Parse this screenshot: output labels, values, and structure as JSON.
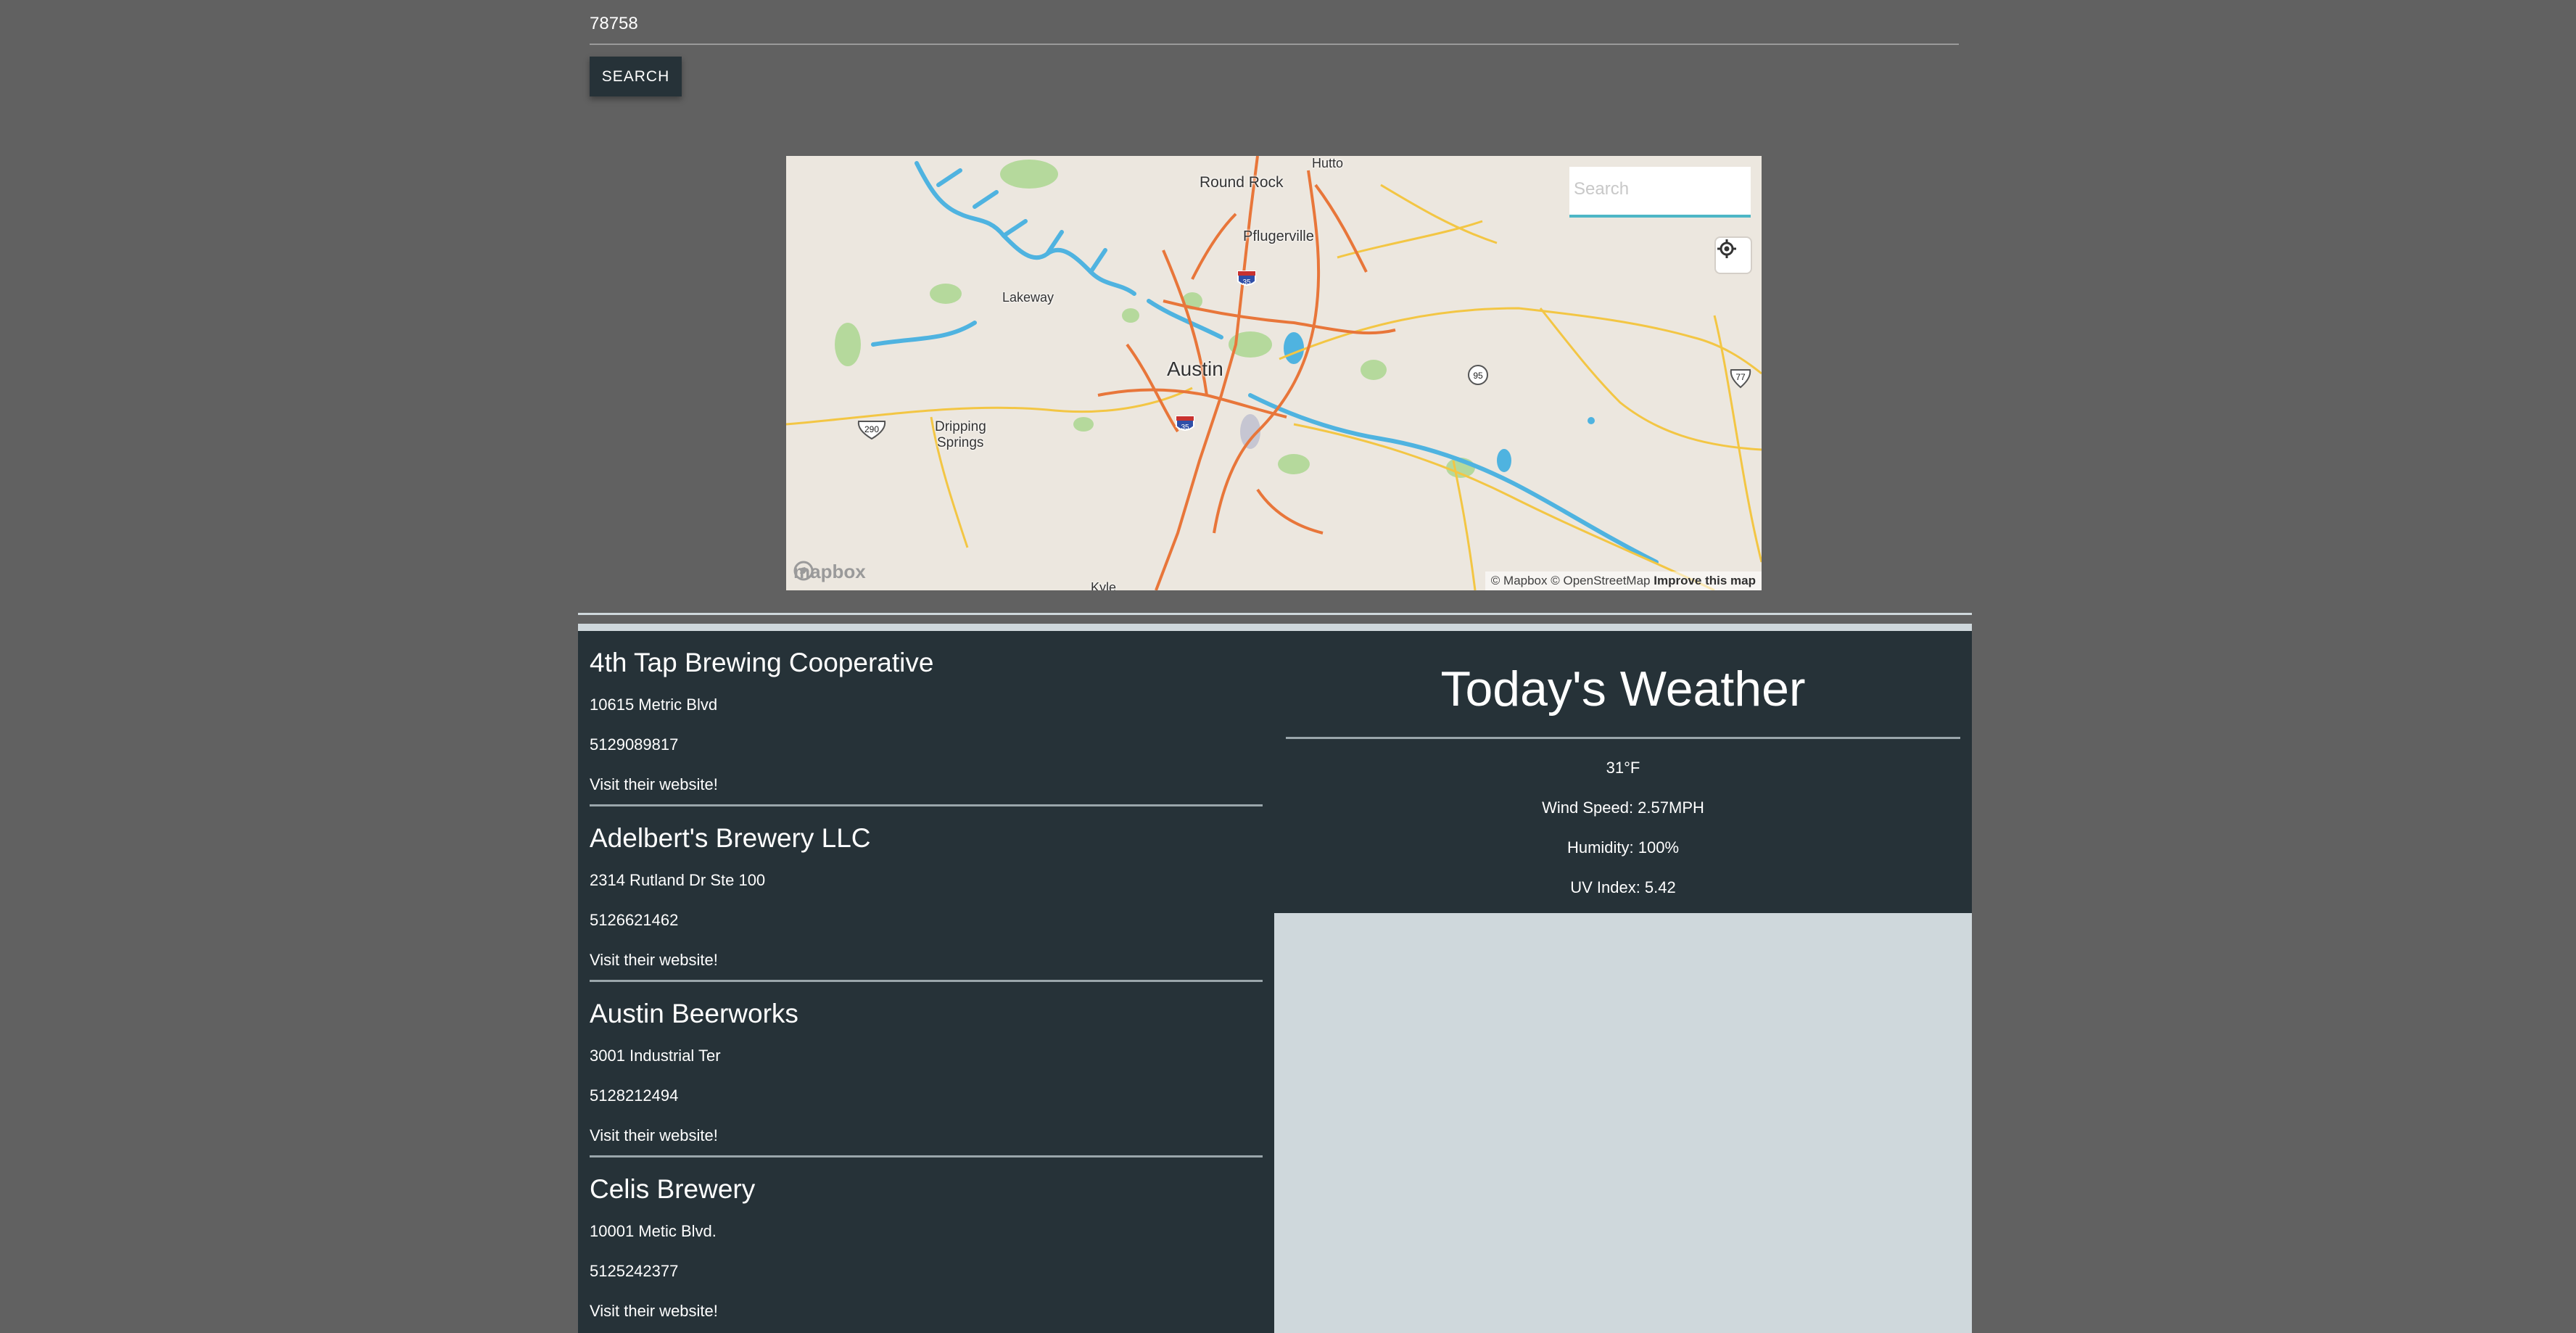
{
  "search": {
    "zip_value": "78758",
    "button_label": "SEARCH"
  },
  "map": {
    "search_placeholder": "Search",
    "labels": {
      "round_rock": "Round Rock",
      "hutto": "Hutto",
      "pflugerville": "Pflugerville",
      "lakeway": "Lakeway",
      "austin": "Austin",
      "dripping": "Dripping",
      "springs": "Springs",
      "kyle": "Kyle",
      "shield_290": "290",
      "shield_35a": "35",
      "shield_35b": "35",
      "shield_95": "95",
      "shield_77": "77"
    },
    "logo_text": "mapbox",
    "attribution": "© Mapbox © OpenStreetMap",
    "improve": "Improve this map",
    "colors": {
      "land": "#ece7df",
      "water": "#4fb3e0",
      "park": "#a8d48a",
      "highway": "#e8773a",
      "road": "#f5c542"
    }
  },
  "breweries": [
    {
      "name": "4th Tap Brewing Cooperative",
      "address": "10615 Metric Blvd",
      "phone": "5129089817",
      "website_label": "Visit their website!"
    },
    {
      "name": "Adelbert's Brewery LLC",
      "address": "2314 Rutland Dr Ste 100",
      "phone": "5126621462",
      "website_label": "Visit their website!"
    },
    {
      "name": "Austin Beerworks",
      "address": "3001 Industrial Ter",
      "phone": "5128212494",
      "website_label": "Visit their website!"
    },
    {
      "name": "Celis Brewery",
      "address": "10001 Metic Blvd.",
      "phone": "5125242377",
      "website_label": "Visit their website!"
    }
  ],
  "weather": {
    "title": "Today's Weather",
    "temp": "31°F",
    "wind": "Wind Speed: 2.57MPH",
    "humidity": "Humidity: 100%",
    "uv": "UV Index: 5.42"
  },
  "colors": {
    "page_bg": "#616161",
    "panel_bg": "#263238",
    "container_bg": "#cfd8dc",
    "text": "#ffffff"
  }
}
